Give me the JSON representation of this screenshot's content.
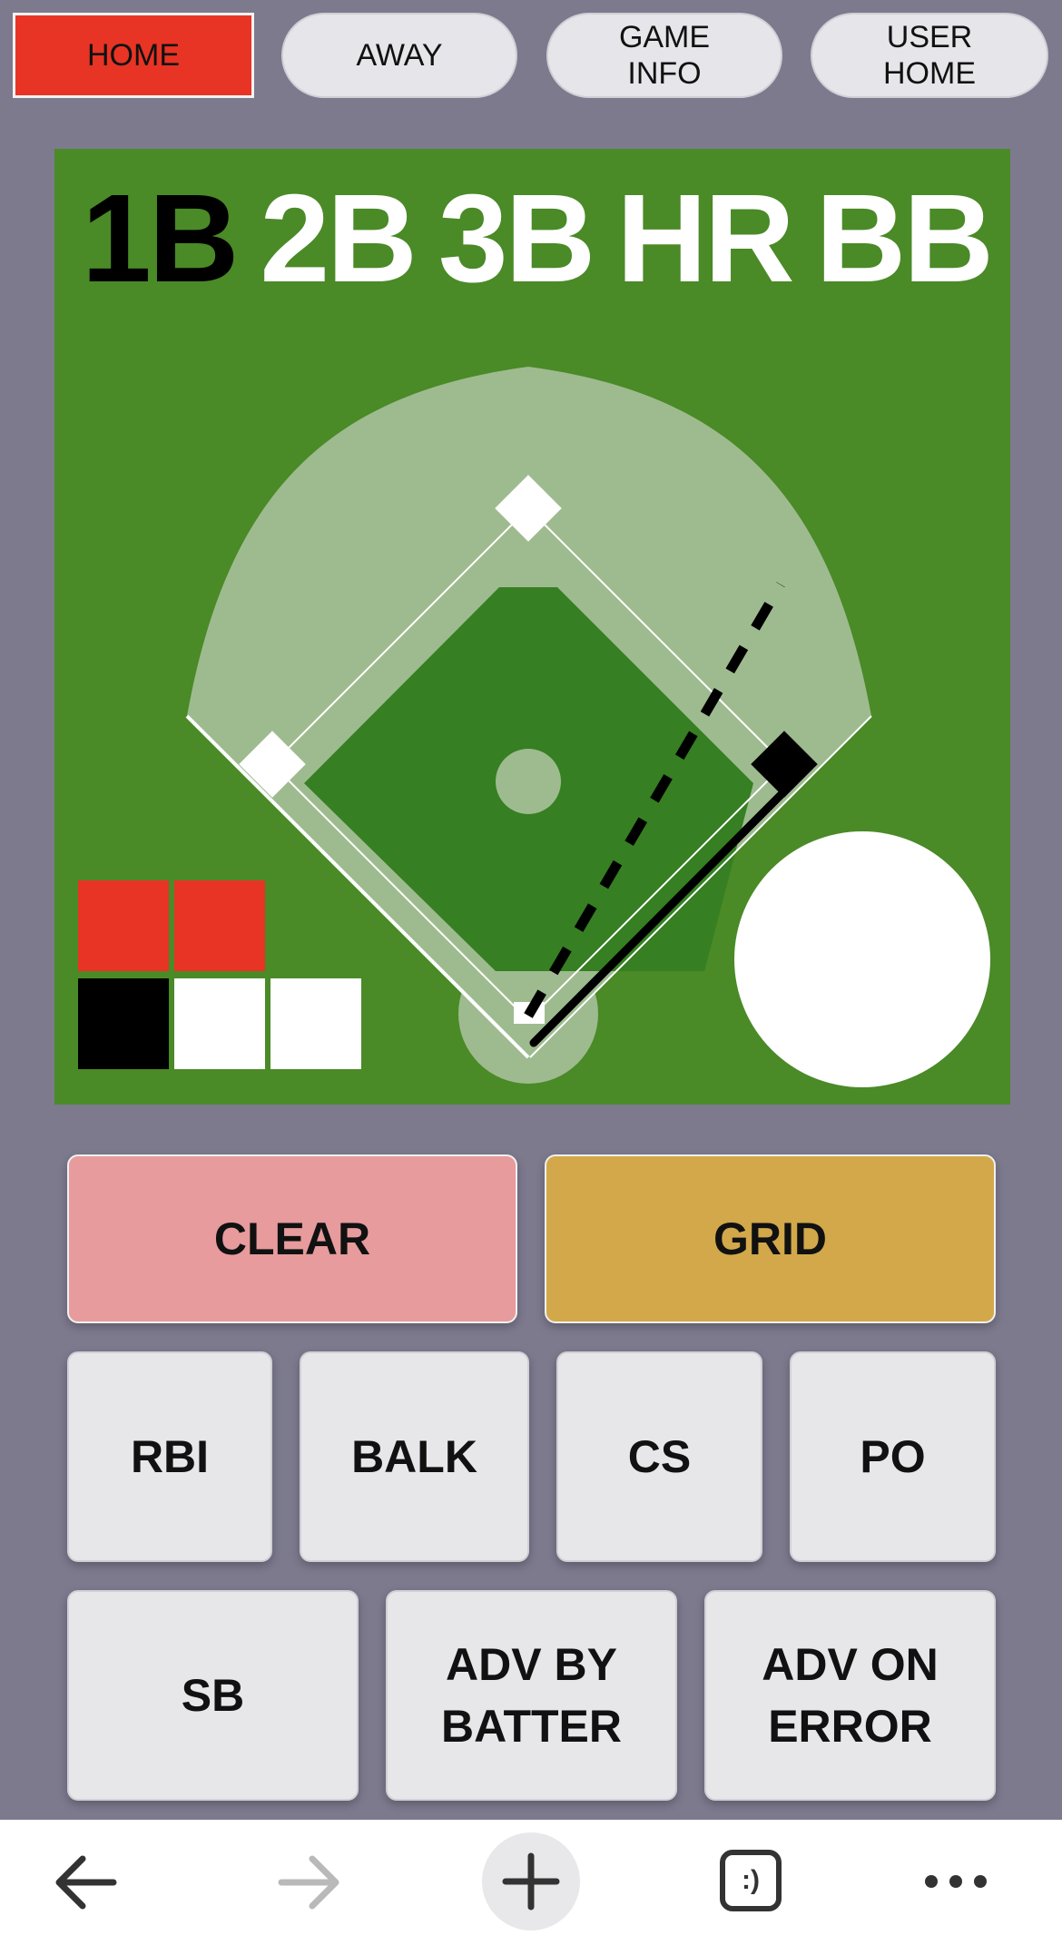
{
  "tabs": [
    {
      "label": "HOME",
      "active": true
    },
    {
      "label": "AWAY",
      "active": false
    },
    {
      "label": "GAME\nINFO",
      "active": false
    },
    {
      "label": "USER\nHOME",
      "active": false
    }
  ],
  "hit_types": [
    {
      "label": "1B",
      "selected": true
    },
    {
      "label": "2B",
      "selected": false
    },
    {
      "label": "3B",
      "selected": false
    },
    {
      "label": "HR",
      "selected": false
    },
    {
      "label": "BB",
      "selected": false
    }
  ],
  "count": {
    "red_boxes_filled": 2,
    "black_boxes_filled": 1,
    "black_boxes_total": 3
  },
  "bases": {
    "first_occupied": true,
    "second_occupied": false,
    "third_occupied": false
  },
  "actions": {
    "clear_label": "CLEAR",
    "grid_label": "GRID",
    "rbi_label": "RBI",
    "balk_label": "BALK",
    "cs_label": "CS",
    "po_label": "PO",
    "sb_label": "SB",
    "adv_by_batter_label": "ADV BY\nBATTER",
    "adv_on_error_label": "ADV ON\nERROR"
  },
  "browser_bar": {
    "back_icon": "arrow-left-icon",
    "forward_icon": "arrow-right-icon",
    "new_tab_icon": "plus-icon",
    "tabs_icon": "tabs-icon",
    "tabs_icon_text": ":)",
    "menu_icon": "ellipsis-icon"
  },
  "colors": {
    "background": "#7d7a8e",
    "field_green": "#4a8a27",
    "infield_green": "#367f22",
    "dirt": "#9ebb8f",
    "active_tab": "#e83424",
    "clear": "#e79b9c",
    "grid": "#d2a84a"
  }
}
